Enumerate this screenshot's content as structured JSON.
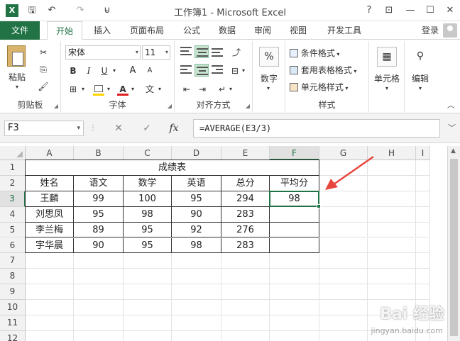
{
  "window": {
    "title": "工作簿1 - Microsoft Excel",
    "logo_letter": "X",
    "help_label": "?",
    "restore_ribbon_label": "⊡",
    "minimize_label": "—",
    "maximize_label": "☐",
    "close_label": "✕"
  },
  "quick_access": {
    "save_label": "🖫",
    "undo_label": "↶",
    "redo_label": "↷",
    "customize_label": "⊌"
  },
  "tabs": [
    {
      "label": "文件"
    },
    {
      "label": "开始"
    },
    {
      "label": "插入"
    },
    {
      "label": "页面布局"
    },
    {
      "label": "公式"
    },
    {
      "label": "数据"
    },
    {
      "label": "审阅"
    },
    {
      "label": "视图"
    },
    {
      "label": "开发工具"
    }
  ],
  "active_tab": "开始",
  "login_label": "登录",
  "ribbon": {
    "clipboard": {
      "paste_label": "粘贴",
      "group_label": "剪贴板"
    },
    "font": {
      "font_name": "宋体",
      "font_size": "11",
      "bold": "B",
      "italic": "I",
      "underline": "U",
      "grow": "A",
      "shrink": "A",
      "font_color_letter": "A",
      "wen": "文",
      "group_label": "字体"
    },
    "alignment": {
      "group_label": "对齐方式"
    },
    "number": {
      "percent_label": "%",
      "label": "数字"
    },
    "styles": {
      "conditional": "条件格式",
      "table": "套用表格格式",
      "cell_styles": "单元格样式",
      "group_label": "样式"
    },
    "cells_label": "单元格",
    "editing_label": "编辑"
  },
  "formula_bar": {
    "name_box": "F3",
    "cancel_label": "✕",
    "enter_label": "✓",
    "fx_label": "fx",
    "formula": "=AVERAGE(E3/3)"
  },
  "grid": {
    "columns": [
      "A",
      "B",
      "C",
      "D",
      "E",
      "F",
      "G",
      "H",
      "I"
    ],
    "rows": [
      "1",
      "2",
      "3",
      "4",
      "5",
      "6",
      "7",
      "8",
      "9",
      "10",
      "11",
      "12"
    ],
    "selected_column": "F",
    "selected_row": "3",
    "sheet_title": "成绩表",
    "headers": [
      "姓名",
      "语文",
      "数学",
      "英语",
      "总分",
      "平均分"
    ],
    "records": [
      [
        "王麟",
        "99",
        "100",
        "95",
        "294",
        "98"
      ],
      [
        "刘思凤",
        "95",
        "98",
        "90",
        "283",
        ""
      ],
      [
        "李兰梅",
        "89",
        "95",
        "92",
        "276",
        ""
      ],
      [
        "宇华晨",
        "90",
        "95",
        "98",
        "283",
        ""
      ]
    ]
  },
  "colors": {
    "accent": "#217346",
    "arrow": "#e8473f"
  },
  "watermark": "Bai 经验",
  "watermark_sub": "jingyan.baidu.com"
}
